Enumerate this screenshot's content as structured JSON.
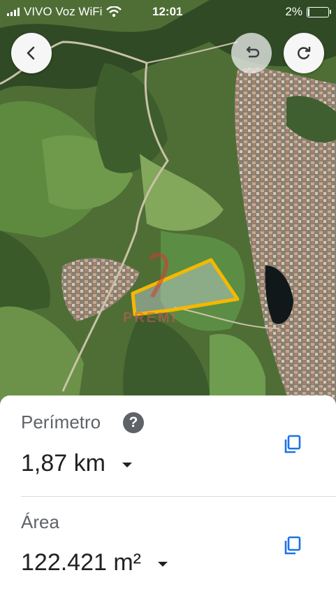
{
  "status_bar": {
    "carrier": "VIVO Voz WiFi",
    "time": "12:01",
    "battery": "2%",
    "battery_level": 0.02
  },
  "map": {
    "watermark": "PREMI",
    "polygon_color": "#f5b800",
    "back_icon": "chevron-left-icon",
    "undo_icon": "undo-icon",
    "redo_icon": "redo-icon"
  },
  "measurement": {
    "perimeter_label": "Perímetro",
    "perimeter_value": "1,87 km",
    "area_label": "Área",
    "area_value": "122.421 m²",
    "help_icon": "help-icon",
    "copy_icon": "copy-icon",
    "accent_color": "#1a73e8"
  }
}
